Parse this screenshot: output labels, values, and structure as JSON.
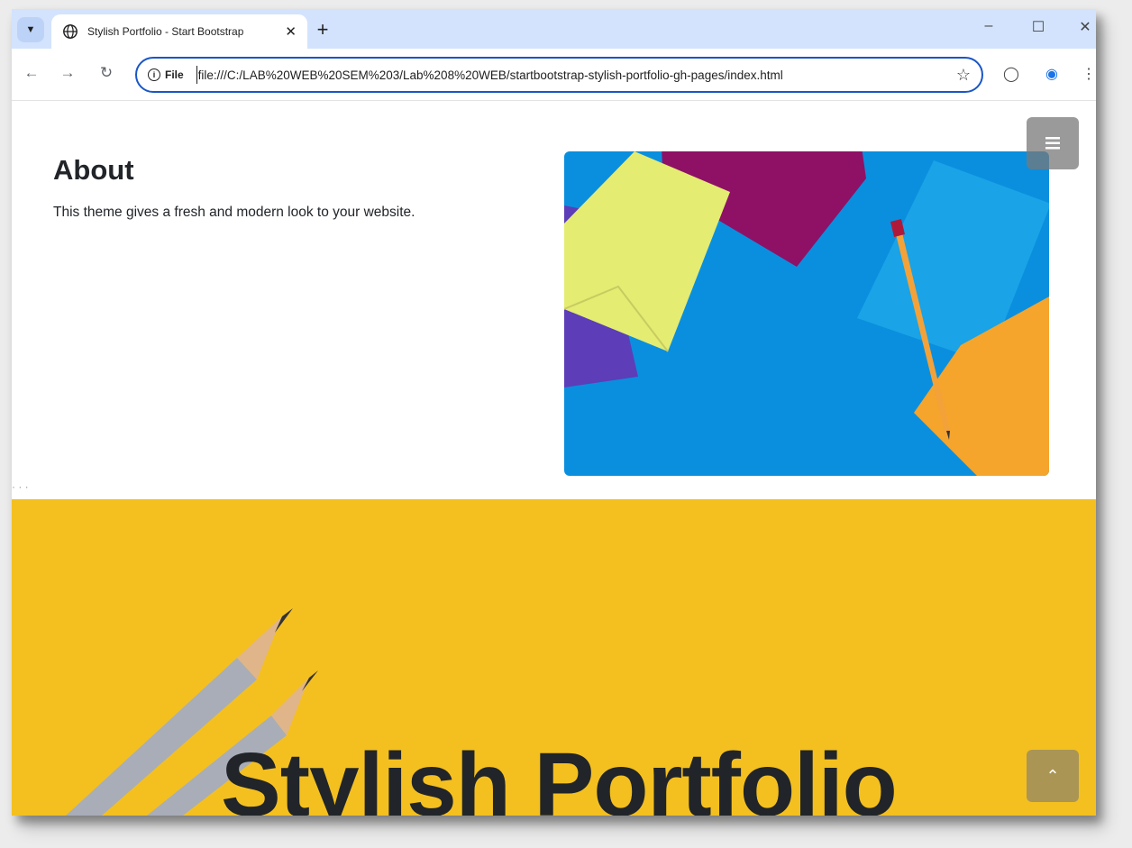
{
  "browser": {
    "tab_title": "Stylish Portfolio - Start Bootstrap",
    "new_tab_label": "+",
    "site_info_label": "File",
    "url": "file:///C:/LAB%20WEB%20SEM%203/Lab%208%20WEB/startbootstrap-stylish-portfolio-gh-pages/index.html",
    "icons": {
      "tab_search": "chevron-down-icon",
      "tab_favicon": "globe-icon",
      "tab_close": "close-icon",
      "minimize": "minimize-icon",
      "maximize": "maximize-icon",
      "close_window": "close-icon",
      "back": "arrow-left-icon",
      "forward": "arrow-right-icon",
      "reload": "reload-icon",
      "bookmark": "star-icon",
      "extensions": "extension-icon",
      "profile": "profile-icon",
      "menu": "more-vert-icon"
    }
  },
  "page": {
    "about": {
      "heading": "About",
      "text": "This theme gives a fresh and modern look to your website."
    },
    "hero": {
      "title": "Stylish Portfolio"
    },
    "colors": {
      "hero_background": "#f4c020",
      "image_background": "#0d8fde",
      "text": "#212529"
    },
    "icons": {
      "menu_toggle": "hamburger-icon",
      "scroll_to_top": "chevron-up-icon"
    }
  }
}
